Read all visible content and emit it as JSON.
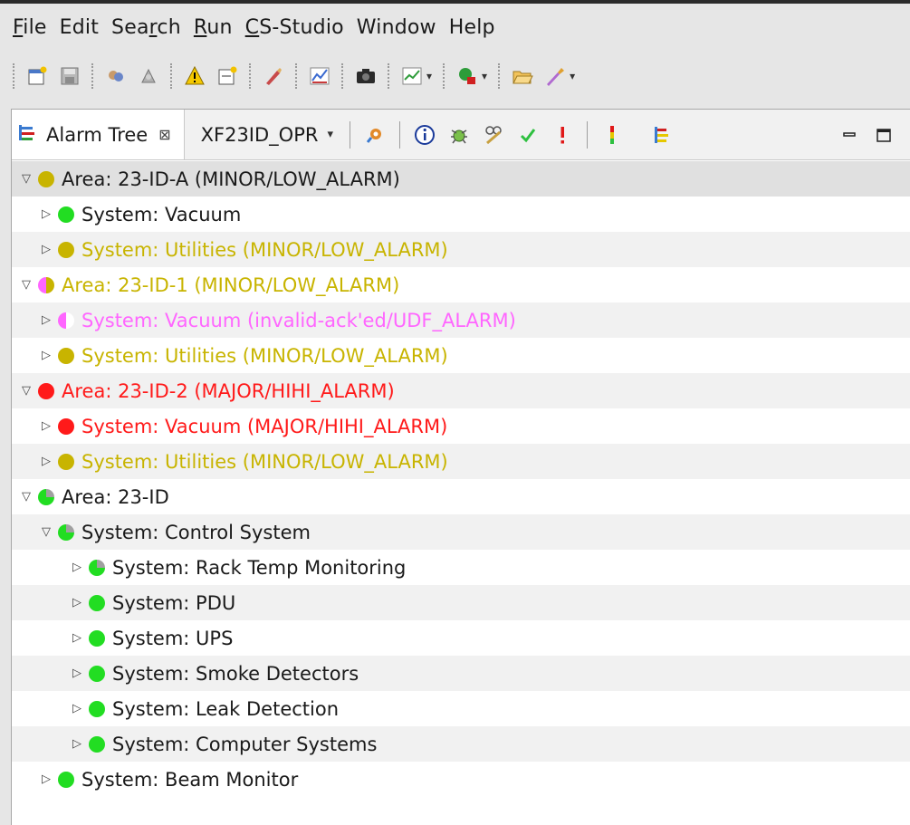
{
  "menu": [
    {
      "mnemonic": "F",
      "rest": "ile"
    },
    {
      "pre": "Edit"
    },
    {
      "pre": "Sea",
      "mnemonic": "r",
      "rest": "ch"
    },
    {
      "mnemonic": "R",
      "rest": "un"
    },
    {
      "mnemonic": "C",
      "rest": "S-Studio"
    },
    {
      "pre": "Window"
    },
    {
      "pre": "Help"
    }
  ],
  "view": {
    "tab_label": "Alarm Tree",
    "close_glyph": "⊠",
    "config_name": "XF23ID_OPR",
    "dropdown_glyph": "▾"
  },
  "colors": {
    "ok": "#22dd22",
    "minor": "#c8b400",
    "major": "#ff1a1a",
    "invalid": "#ff66ff",
    "acked_gray": "#a0a0a0",
    "text_default": "#1a1a1a"
  },
  "tree": [
    {
      "level": 0,
      "expanded": true,
      "status": "minor",
      "text": "Area: 23-ID-A (MINOR/LOW_ALARM)",
      "color": "default"
    },
    {
      "level": 1,
      "expanded": false,
      "status": "ok",
      "text": "System: Vacuum",
      "color": "default"
    },
    {
      "level": 1,
      "expanded": false,
      "status": "minor",
      "text": "System: Utilities (MINOR/LOW_ALARM)",
      "color": "minor"
    },
    {
      "level": 0,
      "expanded": true,
      "status": "minor-invalid",
      "text": "Area: 23-ID-1 (MINOR/LOW_ALARM)",
      "color": "minor"
    },
    {
      "level": 1,
      "expanded": false,
      "status": "invalid",
      "text": "System: Vacuum (invalid-ack'ed/UDF_ALARM)",
      "color": "invalid"
    },
    {
      "level": 1,
      "expanded": false,
      "status": "minor",
      "text": "System: Utilities (MINOR/LOW_ALARM)",
      "color": "minor"
    },
    {
      "level": 0,
      "expanded": true,
      "status": "major",
      "text": "Area: 23-ID-2 (MAJOR/HIHI_ALARM)",
      "color": "major"
    },
    {
      "level": 1,
      "expanded": false,
      "status": "major",
      "text": "System: Vacuum (MAJOR/HIHI_ALARM)",
      "color": "major"
    },
    {
      "level": 1,
      "expanded": false,
      "status": "minor",
      "text": "System: Utilities (MINOR/LOW_ALARM)",
      "color": "minor"
    },
    {
      "level": 0,
      "expanded": true,
      "status": "ok-acked",
      "text": "Area: 23-ID",
      "color": "default"
    },
    {
      "level": 1,
      "expanded": true,
      "status": "ok-acked",
      "text": "System: Control System",
      "color": "default"
    },
    {
      "level": 2,
      "expanded": false,
      "status": "ok-acked",
      "text": "System: Rack Temp Monitoring",
      "color": "default"
    },
    {
      "level": 2,
      "expanded": false,
      "status": "ok",
      "text": "System: PDU",
      "color": "default"
    },
    {
      "level": 2,
      "expanded": false,
      "status": "ok",
      "text": "System: UPS",
      "color": "default"
    },
    {
      "level": 2,
      "expanded": false,
      "status": "ok",
      "text": "System: Smoke Detectors",
      "color": "default"
    },
    {
      "level": 2,
      "expanded": false,
      "status": "ok",
      "text": "System: Leak Detection",
      "color": "default"
    },
    {
      "level": 2,
      "expanded": false,
      "status": "ok",
      "text": "System: Computer Systems",
      "color": "default"
    },
    {
      "level": 1,
      "expanded": false,
      "status": "ok",
      "text": "System: Beam Monitor",
      "color": "default"
    }
  ]
}
